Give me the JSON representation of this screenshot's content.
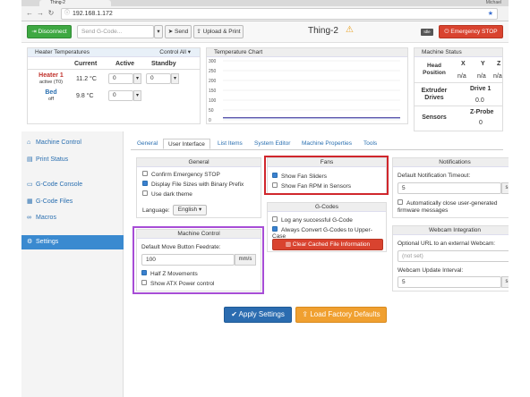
{
  "browser": {
    "tab_title": "Thing-2",
    "user": "Michael",
    "url": "192.168.1.172"
  },
  "toolbar": {
    "disconnect": "Disconnect",
    "gcode_placeholder": "Send G-Code...",
    "send": "Send",
    "upload_print": "Upload & Print",
    "machine_name": "Thing-2",
    "badge": "Idle",
    "emergency_stop": "Emergency STOP"
  },
  "heaters": {
    "title": "Heater Temperatures",
    "control_all": "Control All",
    "columns": [
      "Current",
      "Active",
      "Standby"
    ],
    "rows": [
      {
        "name": "Heater 1",
        "sub": "active (T0)",
        "current": "11.2 °C",
        "active": "0",
        "standby": "0"
      },
      {
        "name": "Bed",
        "sub": "off",
        "current": "9.8 °C",
        "active": "0",
        "standby": ""
      }
    ]
  },
  "temp_chart": {
    "title": "Temperature Chart",
    "y_ticks": [
      "300",
      "250",
      "200",
      "150",
      "100",
      "50",
      "0"
    ]
  },
  "chart_data": {
    "type": "line",
    "ylim": [
      0,
      300
    ],
    "series": [
      {
        "values": [
          11,
          11,
          11,
          11,
          11,
          11,
          11,
          11,
          11,
          11
        ]
      },
      {
        "values": [
          10,
          10,
          10,
          10,
          10,
          10,
          10,
          10,
          10,
          10
        ]
      }
    ],
    "colors": [
      "#c0306a",
      "#3a60c0"
    ]
  },
  "machine_status": {
    "title": "Machine Status",
    "head_position": "Head Position",
    "axes": [
      "X",
      "Y",
      "Z"
    ],
    "axis_values": [
      "n/a",
      "n/a",
      "n/a"
    ],
    "extruder_drives": "Extruder Drives",
    "drive_label": "Drive 1",
    "drive_value": "0.0",
    "sensors": "Sensors",
    "zprobe_label": "Z-Probe",
    "zprobe_value": "0"
  },
  "sidebar": {
    "items": [
      {
        "label": "Machine Control"
      },
      {
        "label": "Print Status"
      },
      {
        "label": "G-Code Console"
      },
      {
        "label": "G-Code Files"
      },
      {
        "label": "Macros"
      },
      {
        "label": "Settings"
      }
    ]
  },
  "tabs": [
    "General",
    "User Interface",
    "List Items",
    "System Editor",
    "Machine Properties",
    "Tools"
  ],
  "general_panel": {
    "title": "General",
    "confirm_estop": "Confirm Emergency STOP",
    "binary_prefix": "Display File Sizes with Binary Prefix",
    "dark_theme": "Use dark theme",
    "language_label": "Language:",
    "language_value": "English"
  },
  "fans_panel": {
    "title": "Fans",
    "show_sliders": "Show Fan Sliders",
    "show_rpm": "Show Fan RPM in Sensors"
  },
  "notifications_panel": {
    "title": "Notifications",
    "timeout_label": "Default Notification Timeout:",
    "timeout_value": "5",
    "timeout_unit": "s",
    "auto_close": "Automatically close user-generated firmware messages"
  },
  "gcodes_panel": {
    "title": "G-Codes",
    "log_any": "Log any successful G-Code",
    "upper_case": "Always Convert G-Codes to Upper-Case",
    "clear_cache": "Clear Cached File Information"
  },
  "machine_control_panel": {
    "title": "Machine Control",
    "feedrate_label": "Default Move Button Feedrate:",
    "feedrate_value": "100",
    "feedrate_unit": "mm/s",
    "half_z": "Half Z Movements",
    "atx": "Show ATX Power control"
  },
  "webcam_panel": {
    "title": "Webcam Integration",
    "url_label": "Optional URL to an external Webcam:",
    "url_placeholder": "(not set)",
    "interval_label": "Webcam Update Interval:",
    "interval_value": "5",
    "interval_unit": "s"
  },
  "footer": {
    "apply": "Apply Settings",
    "load_defaults": "Load Factory Defaults"
  }
}
